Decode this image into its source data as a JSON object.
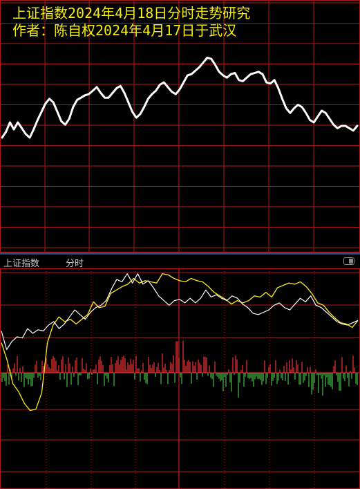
{
  "title": {
    "line1": "上证指数2024年4月18日分时走势研究",
    "line2": "作者：陈自权2024年4月17日于武汉"
  },
  "lower_panel": {
    "index_name": "上证指数",
    "mode": "分时"
  },
  "colors": {
    "grid": "#b01818",
    "forecast_line": "#ffffff",
    "price_line": "#ffffff",
    "avg_line": "#f0e020",
    "volume_up": "#e03030",
    "volume_down": "#40b040",
    "title": "#f5f000",
    "toolbar_text": "#c8c8c8"
  },
  "chart_data": [
    {
      "type": "line",
      "series": [
        {
          "values": [
            0.3,
            0.35,
            0.43,
            0.37,
            0.43,
            0.38,
            0.33,
            0.3,
            0.37,
            0.45,
            0.52,
            0.59,
            0.63,
            0.6,
            0.52,
            0.44,
            0.41,
            0.46,
            0.56,
            0.62,
            0.64,
            0.66,
            0.67,
            0.7,
            0.73,
            0.68,
            0.64,
            0.64,
            0.68,
            0.72,
            0.74,
            0.68,
            0.6,
            0.52,
            0.47,
            0.5,
            0.56,
            0.63,
            0.67,
            0.7,
            0.75,
            0.77,
            0.73,
            0.69,
            0.67,
            0.71,
            0.77,
            0.83,
            0.84,
            0.87,
            0.9,
            0.94,
            0.98,
            0.97,
            0.92,
            0.86,
            0.83,
            0.81,
            0.84,
            0.85,
            0.79,
            0.78,
            0.81,
            0.84,
            0.85,
            0.86,
            0.84,
            0.77,
            0.76,
            0.79,
            0.72,
            0.63,
            0.55,
            0.51,
            0.55,
            0.58,
            0.56,
            0.51,
            0.45,
            0.43,
            0.48,
            0.53,
            0.51,
            0.46,
            0.41,
            0.38,
            0.4,
            0.4,
            0.38,
            0.36,
            0.4
          ]
        }
      ]
    },
    {
      "type": "line",
      "series": [
        {
          "values": [
            0.5,
            0.34,
            0.41,
            0.45,
            0.44,
            0.52,
            0.48,
            0.51,
            0.5,
            0.55,
            0.58,
            0.52,
            0.56,
            0.62,
            0.68,
            0.64,
            0.6,
            0.66,
            0.7,
            0.72,
            0.76,
            0.86,
            0.94,
            0.92,
            0.99,
            0.91,
            0.99,
            0.9,
            0.93,
            0.87,
            0.8,
            0.76,
            0.72,
            0.76,
            0.77,
            0.74,
            0.78,
            0.74,
            0.78,
            0.85,
            0.79,
            0.81,
            0.78,
            0.76,
            0.8,
            0.78,
            0.73,
            0.7,
            0.65,
            0.64,
            0.66,
            0.68,
            0.72,
            0.74,
            0.7,
            0.68,
            0.73,
            0.78,
            0.75,
            0.8,
            0.72,
            0.7,
            0.66,
            0.62,
            0.58,
            0.56,
            0.55,
            0.57,
            0.59
          ]
        },
        {
          "values": [
            0.4,
            0.25,
            0.05,
            -0.02,
            -0.12,
            -0.18,
            -0.17,
            -0.03,
            0.4,
            0.55,
            0.62,
            0.58,
            0.6,
            0.56,
            0.6,
            0.64,
            0.75,
            0.7,
            0.71,
            0.82,
            0.85,
            0.88,
            0.9,
            0.95,
            0.91,
            0.93,
            0.92,
            0.91,
            0.99,
            0.98,
            0.95,
            0.93,
            0.92,
            0.95,
            0.93,
            0.92,
            0.88,
            0.83,
            0.8,
            0.77,
            0.73,
            0.76,
            0.74,
            0.76,
            0.8,
            0.79,
            0.83,
            0.79,
            0.87,
            0.89,
            0.91,
            0.9,
            0.92,
            0.88,
            0.82,
            0.74,
            0.72,
            0.66,
            0.61,
            0.57,
            0.56,
            0.53,
            0.59
          ]
        }
      ]
    }
  ]
}
